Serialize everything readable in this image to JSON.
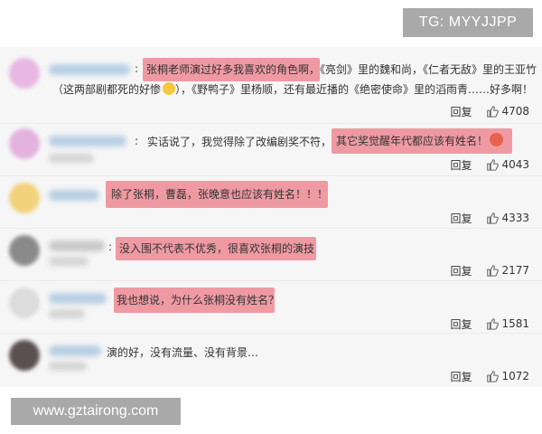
{
  "watermarks": {
    "top": "TG: MYYJJPP",
    "bottom": "www.gztairong.com"
  },
  "reply_label": "回复",
  "comments": [
    {
      "line1": "张桐老师演过好多我喜欢的角色啊，《亮剑》里的魏和尚，《仁者无敌》里的王亚竹",
      "line2": "（这两部剧都死的好惨",
      "line2b": "），《野鸭子》里杨顺，还有最近播的《绝密使命》里的滔雨青……好多啊！",
      "likes": "4708",
      "avatar_color": "#e8b7e3"
    },
    {
      "line1a": "实话说了，我觉得除了改编剧奖不符，",
      "line1b": "其它奖觉醒年代都应该有姓名！",
      "likes": "4043",
      "avatar_color": "#e3b2de"
    },
    {
      "line1": "除了张桐，曹磊，张晚意也应该有姓名！！！",
      "likes": "4333",
      "avatar_color": "#f2d27a"
    },
    {
      "line1": "没入围不代表不优秀，很喜欢张桐的演技",
      "likes": "2177",
      "avatar_color": "#8a8a8a"
    },
    {
      "line1": "我也想说，为什么张桐没有姓名？",
      "likes": "1581",
      "avatar_color": "#dcdcdc"
    },
    {
      "line1": "演的好，没有流量、没有背景…",
      "likes": "1072",
      "avatar_color": "#5a5050"
    }
  ]
}
